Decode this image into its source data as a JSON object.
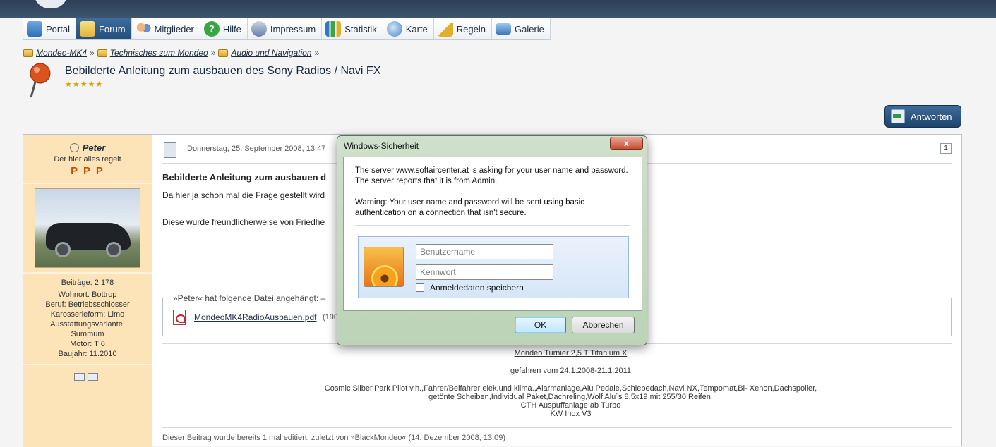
{
  "nav": [
    {
      "label": "Portal",
      "icon": "portal-icon",
      "color": "#2f6fb5"
    },
    {
      "label": "Forum",
      "icon": "forum-icon",
      "color": "#e3b33a",
      "active": true
    },
    {
      "label": "Mitglieder",
      "icon": "members-icon",
      "color": "#d2753a"
    },
    {
      "label": "Hilfe",
      "icon": "help-icon",
      "color": "#39a643"
    },
    {
      "label": "Impressum",
      "icon": "impressum-icon",
      "color": "#6a7fa8"
    },
    {
      "label": "Statistik",
      "icon": "statistics-icon",
      "color": "#2e7bc4"
    },
    {
      "label": "Karte",
      "icon": "globe-icon",
      "color": "#4a86c8"
    },
    {
      "label": "Regeln",
      "icon": "rules-icon",
      "color": "#e0b02a"
    },
    {
      "label": "Galerie",
      "icon": "gallery-icon",
      "color": "#3c78b8"
    }
  ],
  "breadcrumb": [
    "Mondeo-MK4",
    "Technisches zum Mondeo",
    "Audio und Navigation"
  ],
  "breadcrumb_sep": "»",
  "thread": {
    "title": "Bebilderte Anleitung zum ausbauen des Sony Radios / Navi FX",
    "stars": "★★★★★"
  },
  "reply_label": "Antworten",
  "author": {
    "name": "Peter",
    "user_title": "Der hier alles regelt",
    "rank": "P P P",
    "posts": "Beiträge: 2 178",
    "info": [
      "Wohnort: Bottrop",
      "Beruf: Betriebsschlosser",
      "Karosserieform: Limo",
      "Ausstattungsvariante:",
      "Summum",
      "Motor: T 6",
      "Baujahr: 11.2010"
    ]
  },
  "post": {
    "date": "Donnerstag, 25. September 2008, 13:47",
    "number": "1",
    "title": "Bebilderte Anleitung zum ausbauen d",
    "line1": "Da hier ja schon mal die Frage gestellt wird",
    "line2": "Diese wurde freundlicherweise von Friedhe",
    "attachment_legend": "»Peter« hat folgende Datei angehängt: –",
    "attachment_file": "MondeoMK4RadioAusbauen.pdf",
    "attachment_size": "(190",
    "signature": [
      "Mondeo Turnier 2,5 T Titanium X",
      "gefahren vom 24.1.2008-21.1.2011",
      "Cosmic Silber,Park Pilot v.h.,Fahrer/Beifahrer elek.und klima.,Alarmanlage,Alu Pedale,Schiebedach,Navi NX,Tempomat,Bi- Xenon,Dachspoiler,",
      "getönte Scheiben,Individual Paket,Dachreling,Wolf Alu´s 8,5x19 mit 255/30 Reifen,",
      "CTH Auspuffanlage ab Turbo",
      "KW Inox V3"
    ],
    "edited": "Dieser Beitrag wurde bereits 1 mal editiert, zuletzt von »BlackMondeo« (14. Dezember 2008, 13:09)"
  },
  "dialog": {
    "title": "Windows-Sicherheit",
    "close": "x",
    "msg1": "The server www.softaircenter.at is asking for your user name and password. The server reports that it is from Admin.",
    "msg2": "Warning: Your user name and password will be sent using basic authentication on a connection that isn't secure.",
    "username_placeholder": "Benutzername",
    "password_placeholder": "Kennwort",
    "remember": "Anmeldedaten speichern",
    "ok": "OK",
    "cancel": "Abbrechen"
  }
}
